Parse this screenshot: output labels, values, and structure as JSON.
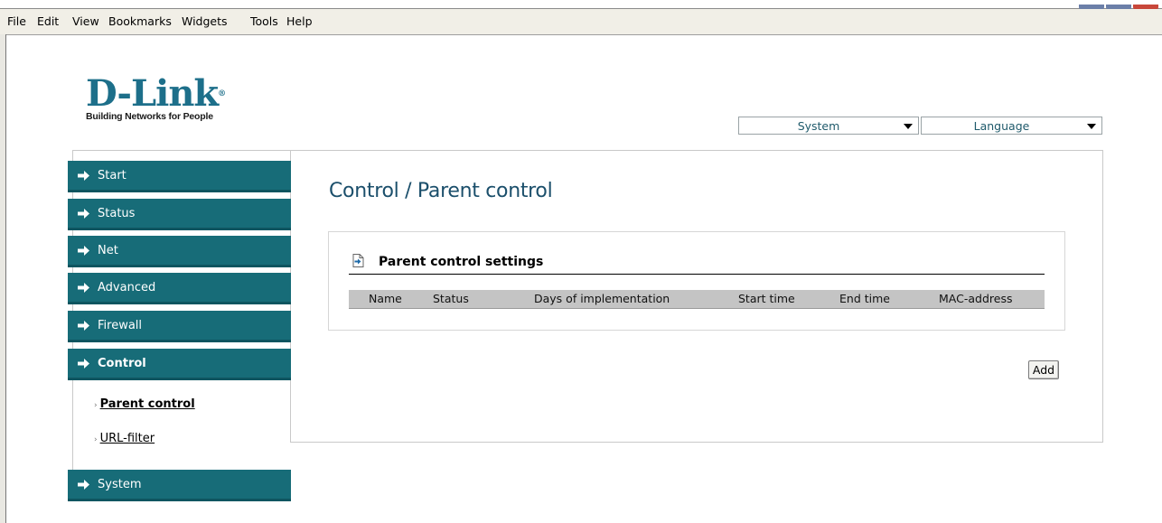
{
  "menubar": {
    "items": [
      {
        "label": "File"
      },
      {
        "label": "Edit"
      },
      {
        "label": "View"
      },
      {
        "label": "Bookmarks"
      },
      {
        "label": "Widgets"
      },
      {
        "label": "Tools"
      },
      {
        "label": "Help"
      }
    ]
  },
  "logo": {
    "brand": "D-Link",
    "registered": "®",
    "tagline": "Building Networks for People"
  },
  "top_selects": {
    "system": {
      "value": "System"
    },
    "language": {
      "value": "Language"
    }
  },
  "sidebar": {
    "items": [
      {
        "label": "Start"
      },
      {
        "label": "Status"
      },
      {
        "label": "Net"
      },
      {
        "label": "Advanced"
      },
      {
        "label": "Firewall"
      },
      {
        "label": "Control",
        "active": true
      },
      {
        "label": "System"
      }
    ],
    "subitems": [
      {
        "label": "Parent control",
        "current": true
      },
      {
        "label": "URL-filter"
      }
    ]
  },
  "main": {
    "title": "Control /  Parent control",
    "panel": {
      "title": "Parent control settings",
      "columns": [
        "Name",
        "Status",
        "Days of implementation",
        "Start time",
        "End time",
        "MAC-address"
      ],
      "rows": []
    },
    "add_label": "Add"
  },
  "colors": {
    "nav_bg": "#176c78",
    "title": "#1b4f6b",
    "select_text": "#1f5a6b",
    "table_header": "#c4c4c4"
  }
}
